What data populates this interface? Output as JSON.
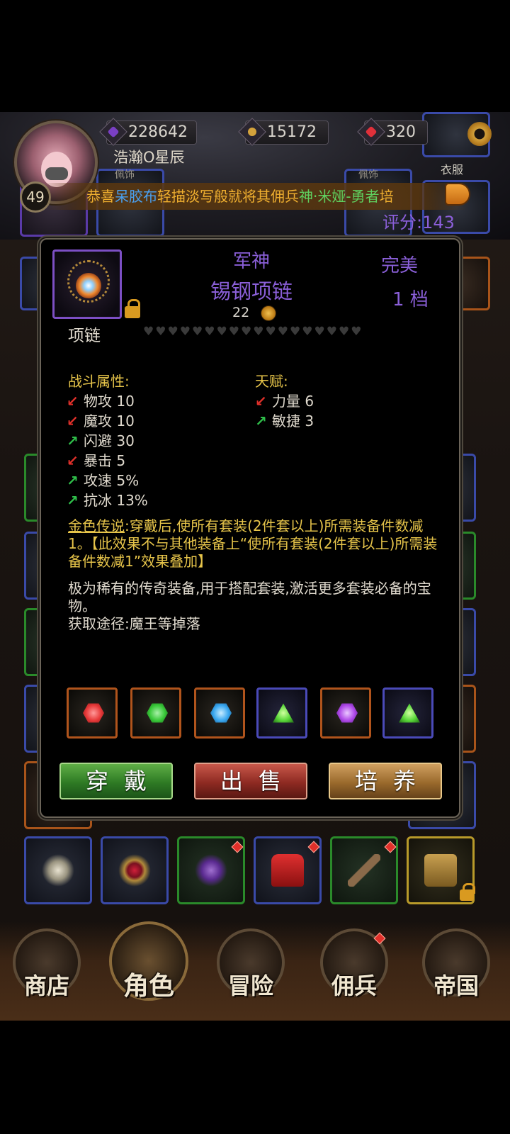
{
  "header": {
    "level": "49",
    "player_name": "浩瀚O星辰",
    "resources": [
      {
        "icon": "crystal-icon",
        "value": "228642",
        "color": "#7a3fc4"
      },
      {
        "icon": "gold-coin-icon",
        "value": "15172",
        "color": "#d4a23c"
      },
      {
        "icon": "ruby-icon",
        "value": "320",
        "color": "#e0303a"
      }
    ],
    "slot_labels": [
      "佩饰",
      "佩饰",
      "衣服"
    ],
    "score": "评分:143"
  },
  "ticker": {
    "segments": [
      {
        "text": "恭喜",
        "color": "#f0b030"
      },
      {
        "text": "呆胶布",
        "color": "#4aa0f0"
      },
      {
        "text": "轻描淡写般就将其佣兵",
        "color": "#f0b030"
      },
      {
        "text": "神·米娅-勇者",
        "color": "#5fd05f"
      },
      {
        "text": "培",
        "color": "#f0b030"
      }
    ]
  },
  "item": {
    "tier": "军神",
    "name": "锡钢项链",
    "quality": "完美",
    "grade": "1 档",
    "price": "22",
    "type": "项链",
    "hearts": 18,
    "combat_title": "战斗属性:",
    "combat_stats": [
      {
        "dir": "down",
        "label": "物攻 10"
      },
      {
        "dir": "down",
        "label": "魔攻 10"
      },
      {
        "dir": "up",
        "label": "闪避 30"
      },
      {
        "dir": "down",
        "label": "暴击 5"
      },
      {
        "dir": "up",
        "label": "攻速 5%"
      },
      {
        "dir": "up",
        "label": "抗冰 13%"
      }
    ],
    "talent_title": "天赋:",
    "talent_stats": [
      {
        "dir": "down",
        "label": "力量 6"
      },
      {
        "dir": "up",
        "label": "敏捷 3"
      }
    ],
    "legend_key": "金色传说",
    "legend_text": ":穿戴后,使所有套装(2件套以上)所需装备件数减1。【此效果不与其他装备上“使所有套装(2件套以上)所需装备件数减1”效果叠加】",
    "desc_line1": "极为稀有的传奇装备,用于搭配套装,激活更多套装必备的宝物。",
    "desc_line2": "获取途径:魔王等掉落",
    "gems": [
      {
        "icon": "red-gem-icon",
        "color": "#e83a3a",
        "shape": "hex",
        "frame": "o"
      },
      {
        "icon": "green-gem-icon",
        "color": "#3ac83a",
        "shape": "hex",
        "frame": "o"
      },
      {
        "icon": "blue-gem-icon",
        "color": "#3aa8f0",
        "shape": "hex",
        "frame": "o"
      },
      {
        "icon": "green-triangle-gem-icon",
        "color": "#5ad83a",
        "shape": "tri",
        "frame": "b"
      },
      {
        "icon": "purple-gem-icon",
        "color": "#b04ae8",
        "shape": "hex",
        "frame": "o"
      },
      {
        "icon": "green-triangle-gem-icon",
        "color": "#5ad83a",
        "shape": "tri",
        "frame": "b"
      }
    ],
    "buttons": {
      "equip": "穿戴",
      "sell": "出售",
      "train": "培养"
    }
  },
  "nav": [
    {
      "label": "商店",
      "icon": "castle-icon"
    },
    {
      "label": "角色",
      "icon": "hooded-character-icon",
      "active": true
    },
    {
      "label": "冒险",
      "icon": "crossed-swords-icon"
    },
    {
      "label": "佣兵",
      "icon": "mercenary-cards-icon"
    },
    {
      "label": "帝国",
      "icon": "crown-icon"
    }
  ]
}
